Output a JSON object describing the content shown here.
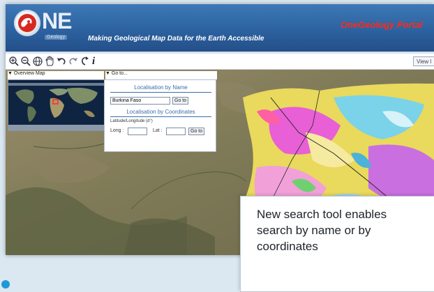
{
  "header": {
    "logo_text": "NE",
    "logo_sub": "Geology",
    "tagline": "Making Geological Map Data for the Earth Accessible",
    "portal_title": "OneGeology Portal"
  },
  "toolbar": {
    "tools": [
      "zoom-in-icon",
      "zoom-out-icon",
      "globe-icon",
      "pan-hand-icon",
      "undo-icon",
      "redo-icon",
      "refresh-icon",
      "info-icon"
    ],
    "info_glyph": "i",
    "view_button_label": "View l"
  },
  "overview_panel": {
    "header": "▼ Overview Map"
  },
  "goto_panel": {
    "header": "▼ Go to...",
    "name_section_title": "Localisation by Name",
    "name_value": "Burkina Faso",
    "name_go_label": "Go to",
    "coord_section_title": "Localisation by Coordinates",
    "coord_hint": "Latitude/Longitude (d°)",
    "long_label": "Long :",
    "lat_label": "Lat :",
    "coord_go_label": "Go to"
  },
  "callout": {
    "text": "New search tool enables search by name or by coordinates"
  },
  "colors": {
    "banner": "#2c62a0",
    "portal_title": "#ff2a1a",
    "section_title": "#3a6ea9",
    "bullet": "#1f9ad8"
  }
}
